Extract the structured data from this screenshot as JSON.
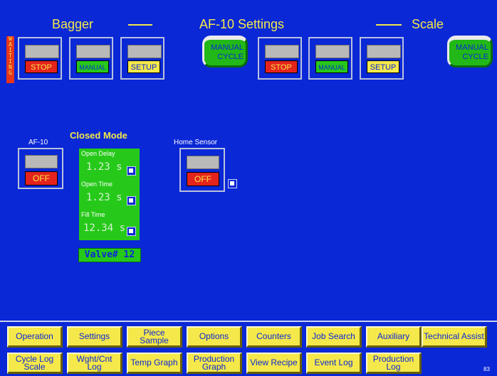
{
  "header": {
    "left_title": "Bagger",
    "center_title": "AF-10 Settings",
    "right_title": "Scale"
  },
  "status": {
    "waiting_label": "WAITING"
  },
  "bagger_controls": {
    "stop": "STOP",
    "manual": "MANUAL",
    "setup": "SETUP",
    "manual_cycle": "MANUAL CYCLE"
  },
  "scale_controls": {
    "stop": "STOP",
    "manual": "MANUAL",
    "setup": "SETUP",
    "manual_cycle": "MANUAL CYCLE"
  },
  "af10": {
    "label": "AF-10",
    "state": "OFF"
  },
  "closed_mode": {
    "title": "Closed Mode",
    "open_delay": {
      "label": "Open Delay",
      "value": "1.23 s"
    },
    "open_time": {
      "label": "Open Time",
      "value": "1.23 s"
    },
    "fill_time": {
      "label": "Fill Time",
      "value": "12.34 s"
    },
    "valve": "Valve# 12"
  },
  "home_sensor": {
    "label": "Home Sensor",
    "state": "OFF"
  },
  "nav_row1": [
    "Operation",
    "Settings",
    "Piece Sample",
    "Options",
    "Counters",
    "Job Search",
    "Auxiliary",
    "Technical Assist"
  ],
  "nav_row2": [
    "Cycle Log Scale",
    "Wght/Cnt Log",
    "Temp Graph",
    "Production Graph",
    "View Recipe",
    "Event Log",
    "Production Log"
  ],
  "screen_number": "83",
  "colors": {
    "background": "#0a28d6",
    "accent_yellow": "#f5e84a",
    "green": "#26c91a",
    "red": "#e4231c"
  }
}
